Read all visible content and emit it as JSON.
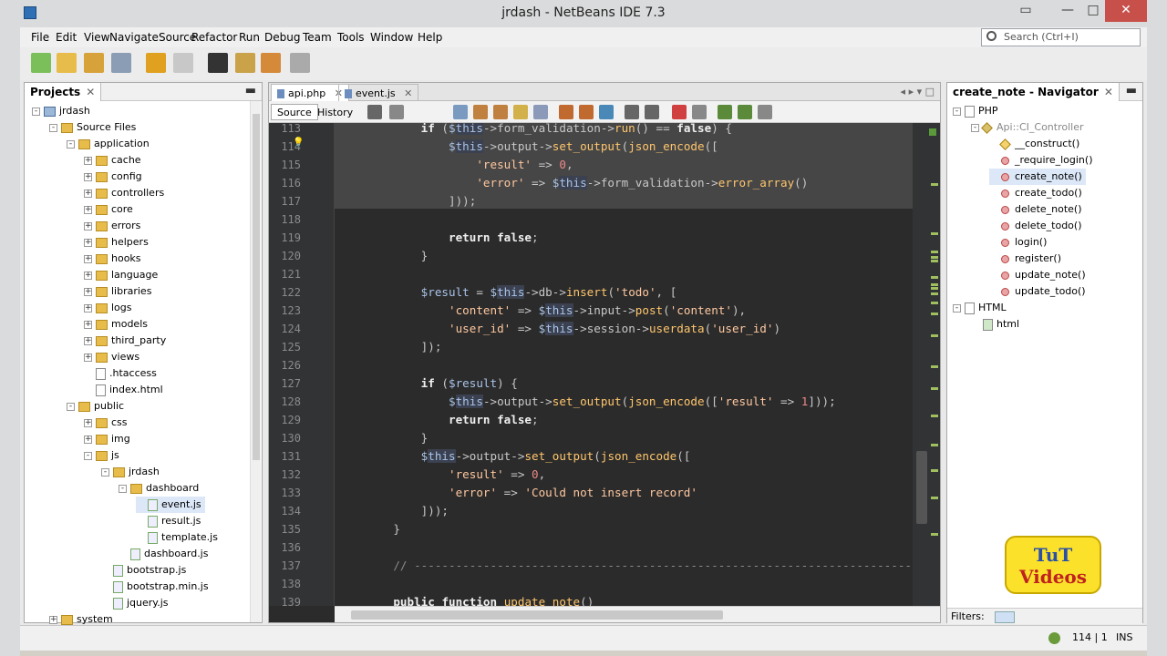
{
  "window": {
    "title": "jrdash - NetBeans IDE 7.3"
  },
  "menu": [
    "File",
    "Edit",
    "View",
    "Navigate",
    "Source",
    "Refactor",
    "Run",
    "Debug",
    "Team",
    "Tools",
    "Window",
    "Help"
  ],
  "search": {
    "placeholder": "Search (Ctrl+I)"
  },
  "projects": {
    "title": "Projects",
    "tree": [
      {
        "label": "jrdash",
        "icon": "project",
        "depth": 0,
        "exp": "-"
      },
      {
        "label": "Source Files",
        "icon": "folder",
        "depth": 1,
        "exp": "-"
      },
      {
        "label": "application",
        "icon": "folder",
        "depth": 2,
        "exp": "-"
      },
      {
        "label": "cache",
        "icon": "folder",
        "depth": 3,
        "exp": "+"
      },
      {
        "label": "config",
        "icon": "folder",
        "depth": 3,
        "exp": "+"
      },
      {
        "label": "controllers",
        "icon": "folder",
        "depth": 3,
        "exp": "+"
      },
      {
        "label": "core",
        "icon": "folder",
        "depth": 3,
        "exp": "+"
      },
      {
        "label": "errors",
        "icon": "folder",
        "depth": 3,
        "exp": "+"
      },
      {
        "label": "helpers",
        "icon": "folder",
        "depth": 3,
        "exp": "+"
      },
      {
        "label": "hooks",
        "icon": "folder",
        "depth": 3,
        "exp": "+"
      },
      {
        "label": "language",
        "icon": "folder",
        "depth": 3,
        "exp": "+"
      },
      {
        "label": "libraries",
        "icon": "folder",
        "depth": 3,
        "exp": "+"
      },
      {
        "label": "logs",
        "icon": "folder",
        "depth": 3,
        "exp": "+"
      },
      {
        "label": "models",
        "icon": "folder",
        "depth": 3,
        "exp": "+"
      },
      {
        "label": "third_party",
        "icon": "folder",
        "depth": 3,
        "exp": "+"
      },
      {
        "label": "views",
        "icon": "folder",
        "depth": 3,
        "exp": "+"
      },
      {
        "label": ".htaccess",
        "icon": "file",
        "depth": 3,
        "exp": ""
      },
      {
        "label": "index.html",
        "icon": "file",
        "depth": 3,
        "exp": ""
      },
      {
        "label": "public",
        "icon": "folder",
        "depth": 2,
        "exp": "-"
      },
      {
        "label": "css",
        "icon": "folder",
        "depth": 3,
        "exp": "+"
      },
      {
        "label": "img",
        "icon": "folder",
        "depth": 3,
        "exp": "+"
      },
      {
        "label": "js",
        "icon": "folder",
        "depth": 3,
        "exp": "-"
      },
      {
        "label": "jrdash",
        "icon": "folder",
        "depth": 4,
        "exp": "-"
      },
      {
        "label": "dashboard",
        "icon": "folder",
        "depth": 5,
        "exp": "-"
      },
      {
        "label": "event.js",
        "icon": "js",
        "depth": 6,
        "exp": "",
        "selected": true
      },
      {
        "label": "result.js",
        "icon": "js",
        "depth": 6,
        "exp": ""
      },
      {
        "label": "template.js",
        "icon": "js",
        "depth": 6,
        "exp": ""
      },
      {
        "label": "dashboard.js",
        "icon": "js",
        "depth": 5,
        "exp": ""
      },
      {
        "label": "bootstrap.js",
        "icon": "js",
        "depth": 4,
        "exp": ""
      },
      {
        "label": "bootstrap.min.js",
        "icon": "js",
        "depth": 4,
        "exp": ""
      },
      {
        "label": "jquery.js",
        "icon": "js",
        "depth": 4,
        "exp": ""
      },
      {
        "label": "system",
        "icon": "folder",
        "depth": 1,
        "exp": "+"
      }
    ]
  },
  "editor": {
    "tabs": [
      {
        "label": "api.php",
        "active": true
      },
      {
        "label": "event.js",
        "active": false
      }
    ],
    "views": [
      {
        "label": "Source",
        "active": true
      },
      {
        "label": "History",
        "active": false
      }
    ],
    "first_line": 113,
    "lines": [
      [
        [
          "        ",
          "t"
        ],
        [
          "if",
          "k"
        ],
        [
          " (",
          "t"
        ],
        [
          "$",
          "v"
        ],
        [
          "this",
          "tv"
        ],
        [
          "->form_validation->",
          "t"
        ],
        [
          "run",
          "f"
        ],
        [
          "() == ",
          "t"
        ],
        [
          "false",
          "k"
        ],
        [
          ") {",
          "t"
        ]
      ],
      [
        [
          "            ",
          "t"
        ],
        [
          "$",
          "v"
        ],
        [
          "this",
          "tv"
        ],
        [
          "->output->",
          "t"
        ],
        [
          "set_output",
          "f"
        ],
        [
          "(",
          "t"
        ],
        [
          "json_encode",
          "f"
        ],
        [
          "([",
          "t"
        ]
      ],
      [
        [
          "                ",
          "t"
        ],
        [
          "'result'",
          "s"
        ],
        [
          " => ",
          "t"
        ],
        [
          "0",
          "n"
        ],
        [
          ",",
          "t"
        ]
      ],
      [
        [
          "                ",
          "t"
        ],
        [
          "'error'",
          "s"
        ],
        [
          " => ",
          "t"
        ],
        [
          "$",
          "v"
        ],
        [
          "this",
          "tv"
        ],
        [
          "->form_validation->",
          "t"
        ],
        [
          "error_array",
          "f"
        ],
        [
          "()",
          "t"
        ]
      ],
      [
        [
          "            ]));",
          "t"
        ]
      ],
      [
        [
          "",
          "t"
        ]
      ],
      [
        [
          "            ",
          "t"
        ],
        [
          "return",
          "k"
        ],
        [
          " ",
          "t"
        ],
        [
          "false",
          "k"
        ],
        [
          ";",
          "t"
        ]
      ],
      [
        [
          "        }",
          "t"
        ]
      ],
      [
        [
          "",
          "t"
        ]
      ],
      [
        [
          "        ",
          "t"
        ],
        [
          "$result",
          "v"
        ],
        [
          " = ",
          "t"
        ],
        [
          "$",
          "v"
        ],
        [
          "this",
          "tv"
        ],
        [
          "->db->",
          "t"
        ],
        [
          "insert",
          "f"
        ],
        [
          "(",
          "t"
        ],
        [
          "'todo'",
          "s"
        ],
        [
          ", [",
          "t"
        ]
      ],
      [
        [
          "            ",
          "t"
        ],
        [
          "'content'",
          "s"
        ],
        [
          " => ",
          "t"
        ],
        [
          "$",
          "v"
        ],
        [
          "this",
          "tv"
        ],
        [
          "->input->",
          "t"
        ],
        [
          "post",
          "f"
        ],
        [
          "(",
          "t"
        ],
        [
          "'content'",
          "s"
        ],
        [
          "),",
          "t"
        ]
      ],
      [
        [
          "            ",
          "t"
        ],
        [
          "'user_id'",
          "s"
        ],
        [
          " => ",
          "t"
        ],
        [
          "$",
          "v"
        ],
        [
          "this",
          "tv"
        ],
        [
          "->session->",
          "t"
        ],
        [
          "userdata",
          "f"
        ],
        [
          "(",
          "t"
        ],
        [
          "'user_id'",
          "s"
        ],
        [
          ")",
          "t"
        ]
      ],
      [
        [
          "        ]);",
          "t"
        ]
      ],
      [
        [
          "",
          "t"
        ]
      ],
      [
        [
          "        ",
          "t"
        ],
        [
          "if",
          "k"
        ],
        [
          " (",
          "t"
        ],
        [
          "$result",
          "v"
        ],
        [
          ") {",
          "t"
        ]
      ],
      [
        [
          "            ",
          "t"
        ],
        [
          "$",
          "v"
        ],
        [
          "this",
          "tv"
        ],
        [
          "->output->",
          "t"
        ],
        [
          "set_output",
          "f"
        ],
        [
          "(",
          "t"
        ],
        [
          "json_encode",
          "f"
        ],
        [
          "([",
          "t"
        ],
        [
          "'result'",
          "s"
        ],
        [
          " => ",
          "t"
        ],
        [
          "1",
          "n"
        ],
        [
          "]));",
          "t"
        ]
      ],
      [
        [
          "            ",
          "t"
        ],
        [
          "return",
          "k"
        ],
        [
          " ",
          "t"
        ],
        [
          "false",
          "k"
        ],
        [
          ";",
          "t"
        ]
      ],
      [
        [
          "        }",
          "t"
        ]
      ],
      [
        [
          "        ",
          "t"
        ],
        [
          "$",
          "v"
        ],
        [
          "this",
          "tv"
        ],
        [
          "->output->",
          "t"
        ],
        [
          "set_output",
          "f"
        ],
        [
          "(",
          "t"
        ],
        [
          "json_encode",
          "f"
        ],
        [
          "([",
          "t"
        ]
      ],
      [
        [
          "            ",
          "t"
        ],
        [
          "'result'",
          "s"
        ],
        [
          " => ",
          "t"
        ],
        [
          "0",
          "n"
        ],
        [
          ",",
          "t"
        ]
      ],
      [
        [
          "            ",
          "t"
        ],
        [
          "'error'",
          "s"
        ],
        [
          " => ",
          "t"
        ],
        [
          "'Could not insert record'",
          "s"
        ]
      ],
      [
        [
          "        ]));",
          "t"
        ]
      ],
      [
        [
          "    }",
          "t"
        ]
      ],
      [
        [
          "",
          "t"
        ]
      ],
      [
        [
          "    ",
          "t"
        ],
        [
          "// -------------------------------------------------------------------------------",
          "c"
        ]
      ],
      [
        [
          "",
          "t"
        ]
      ],
      [
        [
          "    ",
          "t"
        ],
        [
          "public",
          "k"
        ],
        [
          " ",
          "t"
        ],
        [
          "function",
          "k"
        ],
        [
          " ",
          "t"
        ],
        [
          "update_note",
          "f"
        ],
        [
          "()",
          "t"
        ]
      ]
    ]
  },
  "navigator": {
    "title": "create_note - Navigator",
    "tree": [
      {
        "label": "PHP",
        "icon": "folder",
        "depth": 0,
        "exp": "-"
      },
      {
        "label": "Api::CI_Controller",
        "icon": "class",
        "depth": 1,
        "exp": "-",
        "muted": true
      },
      {
        "label": "__construct()",
        "icon": "ctor",
        "depth": 2,
        "exp": ""
      },
      {
        "label": "_require_login()",
        "icon": "meth",
        "depth": 2,
        "exp": ""
      },
      {
        "label": "create_note()",
        "icon": "meth",
        "depth": 2,
        "exp": "",
        "selected": true
      },
      {
        "label": "create_todo()",
        "icon": "meth",
        "depth": 2,
        "exp": ""
      },
      {
        "label": "delete_note()",
        "icon": "meth",
        "depth": 2,
        "exp": ""
      },
      {
        "label": "delete_todo()",
        "icon": "meth",
        "depth": 2,
        "exp": ""
      },
      {
        "label": "login()",
        "icon": "meth",
        "depth": 2,
        "exp": ""
      },
      {
        "label": "register()",
        "icon": "meth",
        "depth": 2,
        "exp": ""
      },
      {
        "label": "update_note()",
        "icon": "meth",
        "depth": 2,
        "exp": ""
      },
      {
        "label": "update_todo()",
        "icon": "meth",
        "depth": 2,
        "exp": ""
      },
      {
        "label": "HTML",
        "icon": "folder",
        "depth": 0,
        "exp": "-"
      },
      {
        "label": "html",
        "icon": "tag",
        "depth": 1,
        "exp": ""
      }
    ],
    "filters_label": "Filters:"
  },
  "status": {
    "position": "114 | 1",
    "mode": "INS"
  },
  "logo": {
    "line1": "TuT",
    "line2": "Videos"
  }
}
